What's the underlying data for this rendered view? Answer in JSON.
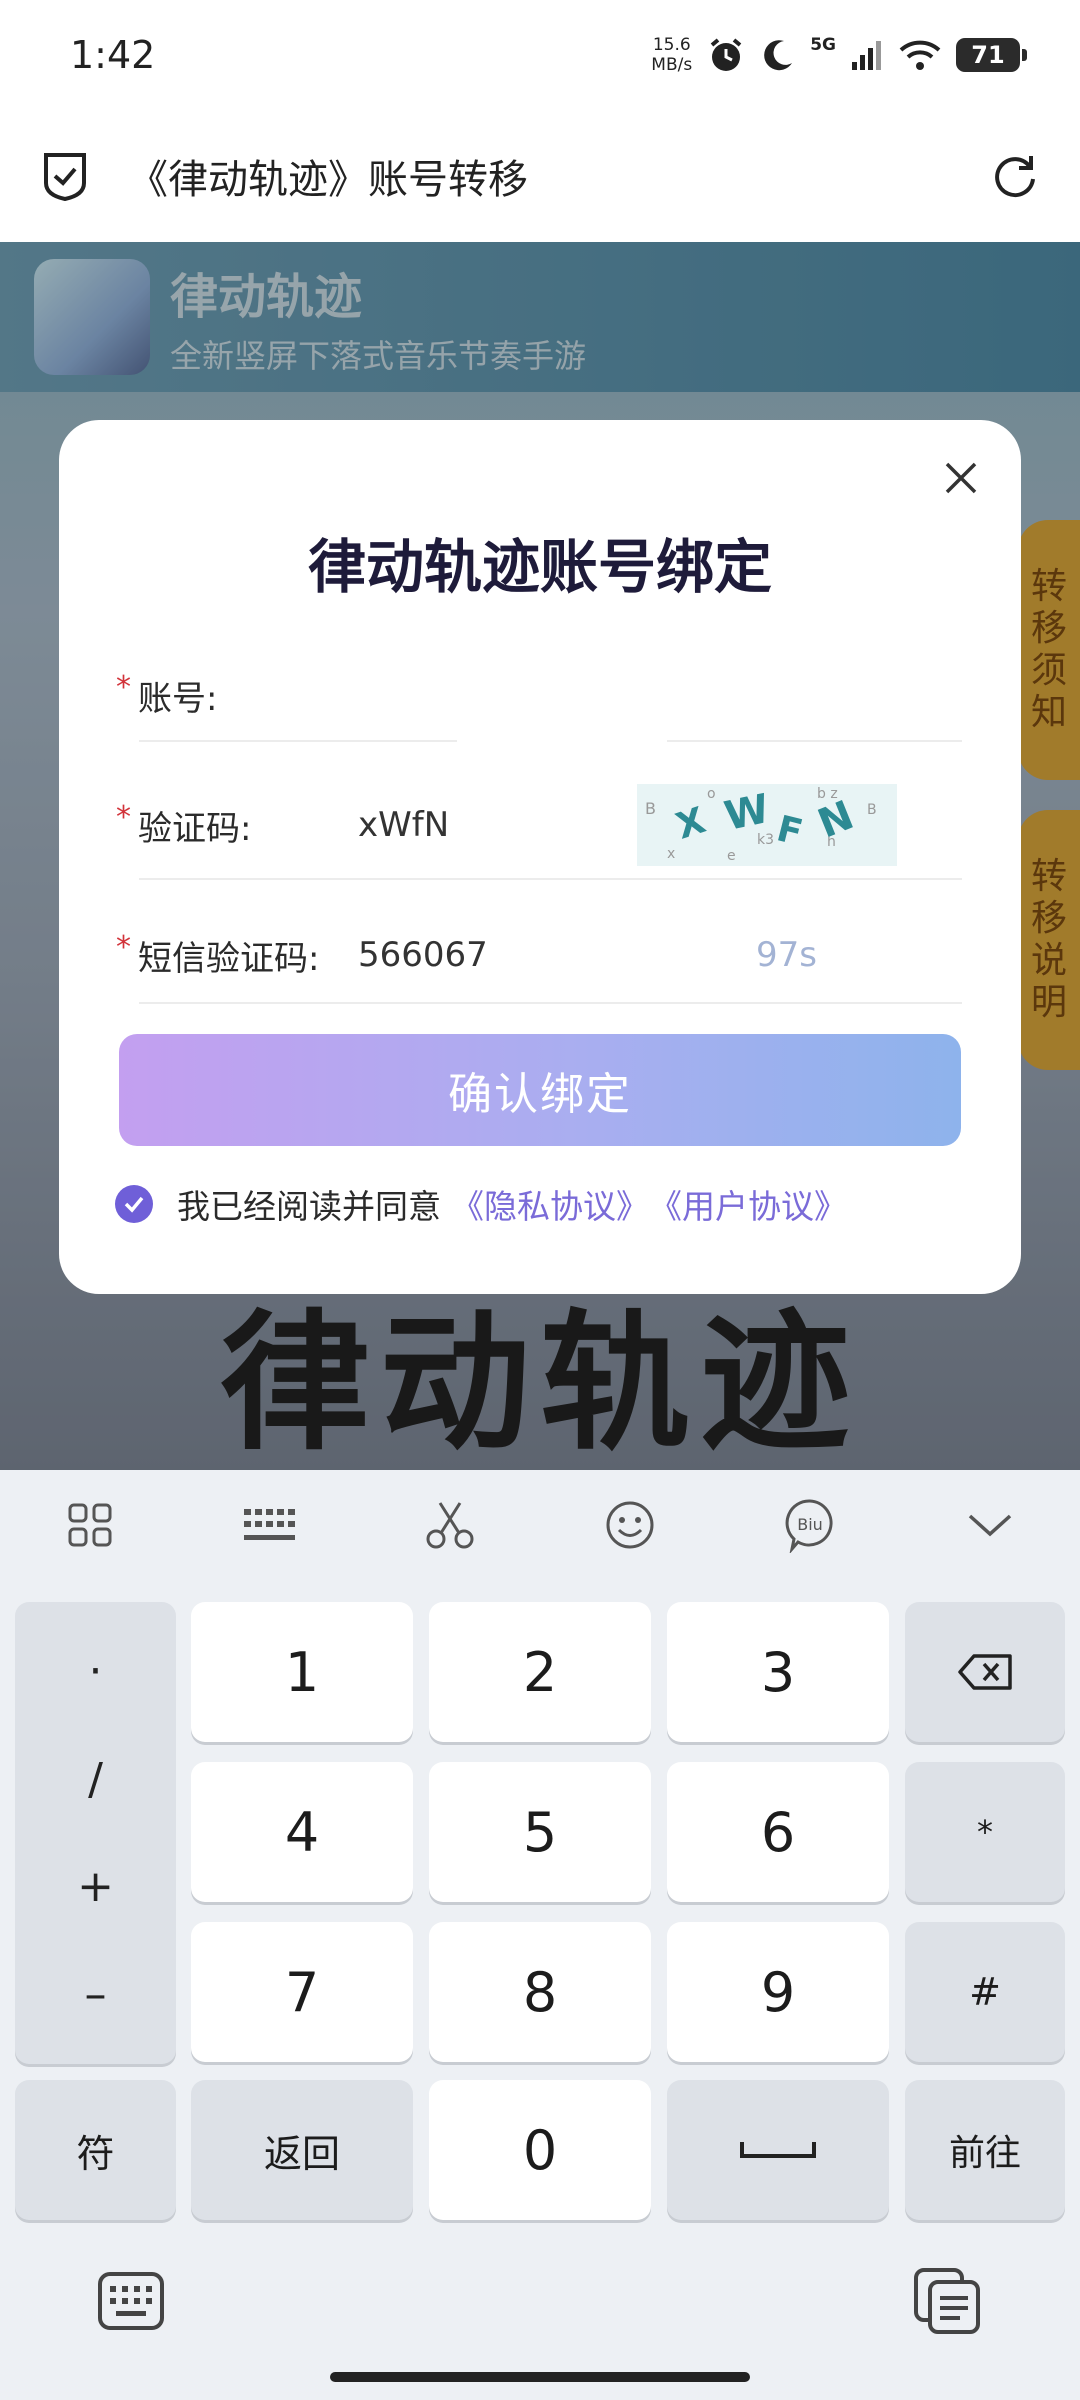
{
  "status_bar": {
    "time": "1:42",
    "net_speed_value": "15.6",
    "net_speed_unit": "MB/s",
    "network": "5G",
    "battery": "71"
  },
  "title_bar": {
    "title": "《律动轨迹》账号转移",
    "left_icon": "shield-check-icon",
    "right_icon": "refresh-icon"
  },
  "background": {
    "banner_title": "律动轨迹",
    "banner_subtitle": "全新竖屏下落式音乐节奏手游",
    "side_tab_1": "转移须知",
    "side_tab_2": "转移说明",
    "logo_text": "律动轨迹"
  },
  "modal": {
    "title": "律动轨迹账号绑定",
    "account_label": "账号:",
    "account_value": "",
    "captcha_label": "验证码:",
    "captcha_value": "xWfN",
    "captcha_image_text": "XWFN",
    "sms_label": "短信验证码:",
    "sms_value": "566067",
    "countdown": "97s",
    "confirm_button": "确认绑定",
    "agree_text": "我已经阅读并同意",
    "privacy_link": "《隐私协议》",
    "user_link": "《用户协议》"
  },
  "keyboard": {
    "symbols": [
      "·",
      "/",
      "+",
      "–"
    ],
    "keys": [
      "1",
      "2",
      "3",
      "4",
      "5",
      "6",
      "7",
      "8",
      "9",
      "0"
    ],
    "star": "*",
    "hash": "#",
    "symbol_key": "符",
    "back_key": "返回",
    "go_key": "前往"
  },
  "colors": {
    "accent": "#6f5fd8",
    "button_gradient_start": "#c39ff0",
    "button_gradient_end": "#8eb3ec",
    "side_tab": "#d7a43a"
  }
}
